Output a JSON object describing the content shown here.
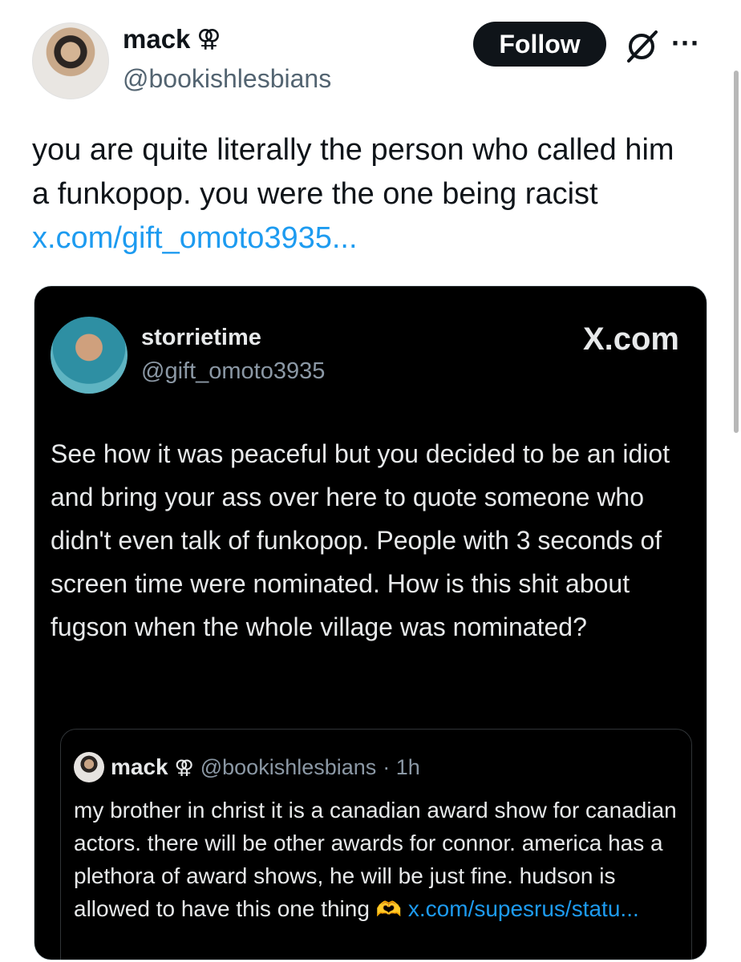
{
  "author": {
    "name": "mack",
    "symbol": "⚢",
    "handle": "@bookishlesbians",
    "avatar_icon": "avatar-photo"
  },
  "actions": {
    "follow_label": "Follow",
    "more_label": "···"
  },
  "tweet": {
    "text": "you are quite literally the person who called him a funkopop. you were the one being racist ",
    "link": "x.com/gift_omoto3935..."
  },
  "card": {
    "name": "storrietime",
    "handle": "@gift_omoto3935",
    "source": "X.com",
    "body": "See how it was peaceful but you decided to be an idiot and bring your ass over here to quote someone who didn't even talk of funkopop. People with 3 seconds of screen time were nominated. How is this shit about fugson when the whole village was nominated?",
    "quote": {
      "name": "mack",
      "symbol": "⚢",
      "handle": "@bookishlesbians",
      "time": "· 1h",
      "body": "my brother in christ it is a canadian award show for canadian actors. there will be other awards for connor. america has a plethora of award shows, he will be just fine. hudson is allowed to have this one thing",
      "emoji": "🫶",
      "link": "x.com/supesrus/statu..."
    }
  },
  "colors": {
    "link": "#1d9bf0",
    "follow_bg": "#0f1419",
    "card_bg": "#000000"
  }
}
